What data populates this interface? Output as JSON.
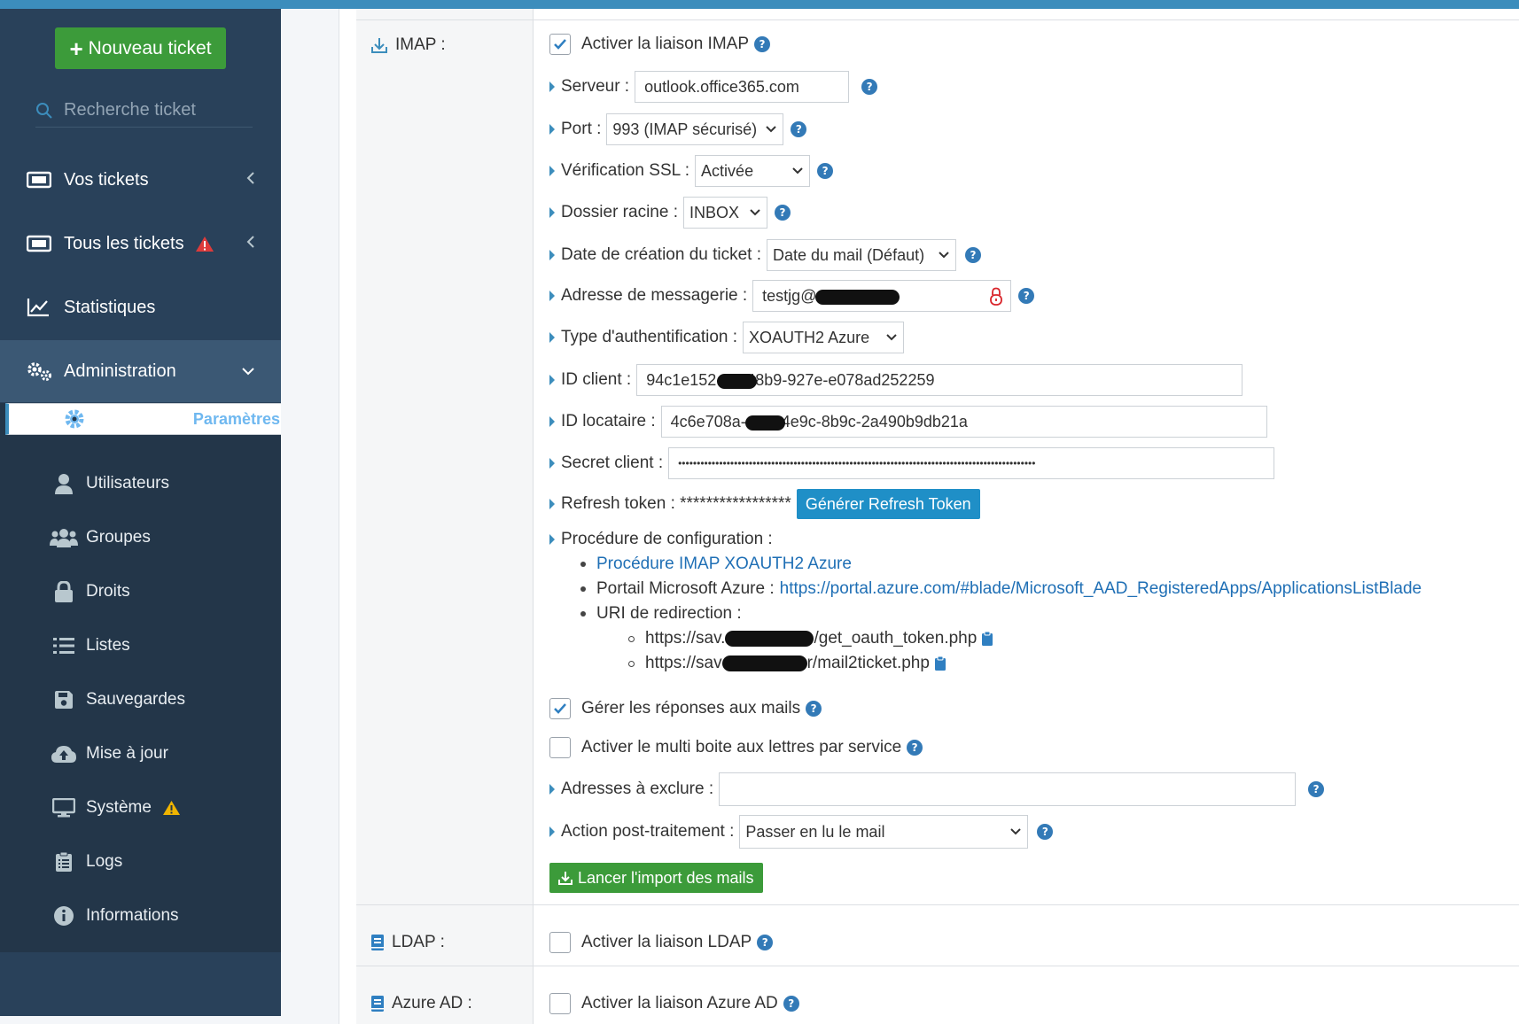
{
  "sidebar": {
    "new_ticket_label": "Nouveau ticket",
    "search_placeholder": "Recherche ticket",
    "items": [
      {
        "label": "Vos tickets"
      },
      {
        "label": "Tous les tickets"
      },
      {
        "label": "Statistiques"
      },
      {
        "label": "Administration"
      }
    ],
    "subitems": [
      {
        "label": "Paramètres"
      },
      {
        "label": "Utilisateurs"
      },
      {
        "label": "Groupes"
      },
      {
        "label": "Droits"
      },
      {
        "label": "Listes"
      },
      {
        "label": "Sauvegardes"
      },
      {
        "label": "Mise à jour"
      },
      {
        "label": "Système"
      },
      {
        "label": "Logs"
      },
      {
        "label": "Informations"
      }
    ]
  },
  "imap": {
    "section_label": "IMAP :",
    "enable_label": "Activer la liaison IMAP",
    "server_label": "Serveur :",
    "server_value": "outlook.office365.com",
    "port_label": "Port :",
    "port_value": "993 (IMAP sécurisé)",
    "ssl_label": "Vérification SSL :",
    "ssl_value": "Activée",
    "folder_label": "Dossier racine :",
    "folder_value": "INBOX",
    "date_label": "Date de création du ticket :",
    "date_value": "Date du mail (Défaut)",
    "email_label": "Adresse de messagerie :",
    "email_value": "testjg@",
    "auth_label": "Type d'authentification :",
    "auth_value": "XOAUTH2 Azure",
    "client_id_label": "ID client :",
    "client_id_a": "94c1e152-",
    "client_id_b": "-48b9-927e-e078ad252259",
    "tenant_label": "ID locataire :",
    "tenant_a": "4c6e708a-",
    "tenant_b": "-4e9c-8b9c-2a490b9db21a",
    "secret_label": "Secret client :",
    "secret_value": "••••••••••••••••••••••••••••••••••••••••••••••••••••••••••••••••••••••••••••••••••••••••••••••••",
    "refresh_label": "Refresh token : *****************",
    "refresh_button": "Générer Refresh Token",
    "procedure_label": "Procédure de configuration :",
    "proc_link": "Procédure IMAP XOAUTH2 Azure",
    "portal_label": "Portail Microsoft Azure :",
    "portal_link": "https://portal.azure.com/#blade/Microsoft_AAD_RegisteredApps/ApplicationsListBlade",
    "uri_label": "URI de redirection :",
    "uri1_a": "https://sav.",
    "uri1_b": "/get_oauth_token.php",
    "uri2_a": "https://sav",
    "uri2_b": "r/mail2ticket.php",
    "manage_replies_label": "Gérer les réponses aux mails",
    "multi_mailbox_label": "Activer le multi boite aux lettres par service",
    "exclude_label": "Adresses à exclure :",
    "exclude_value": "",
    "post_action_label": "Action post-traitement :",
    "post_action_value": "Passer en lu le mail",
    "import_button": "Lancer l'import des mails"
  },
  "ldap": {
    "section_label": "LDAP :",
    "enable_label": "Activer la liaison LDAP"
  },
  "azure": {
    "section_label": "Azure AD :",
    "enable_label": "Activer la liaison Azure AD"
  },
  "help_glyph": "?",
  "colors": {
    "sidebar_bg": "#29415a",
    "accent": "#3c8dbc",
    "green": "#3c9b3a",
    "help_blue": "#337ab7"
  }
}
